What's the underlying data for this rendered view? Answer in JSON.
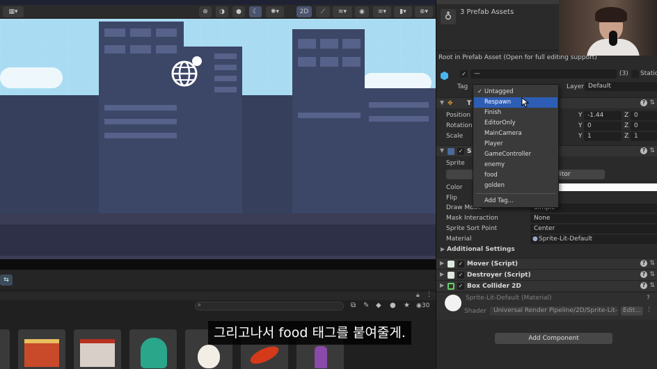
{
  "scene_toolbar": {
    "mode_2d_label": "2D"
  },
  "project_panel": {
    "visible_count": "30"
  },
  "subtitle": "그리고나서 food 태그를 붙여줄게.",
  "inspector": {
    "header_title": "3 Prefab Assets",
    "root_note": "Root in Prefab Asset (Open for full editing support)",
    "object_count": "(3)",
    "static_label": "Static",
    "object_name_placeholder": "—",
    "tag_label": "Tag",
    "layer_label": "Layer",
    "layer_value": "Default",
    "transform": {
      "letter": "T",
      "position_label": "Position",
      "rotation_label": "Rotation",
      "scale_label": "Scale",
      "y_axis": "Y",
      "z_axis": "Z",
      "position_y": "-1.44",
      "position_z": "0",
      "rotation_y": "0",
      "rotation_z": "0",
      "scale_y": "1",
      "scale_z": "1"
    },
    "sprite_renderer": {
      "letter": "S",
      "sprite_label": "Sprite",
      "sprite_editor_button": "te Editor",
      "color_label": "Color",
      "flip_label": "Flip",
      "draw_mode_label": "Draw Mode",
      "draw_mode_value": "Simple",
      "mask_interaction_label": "Mask Interaction",
      "mask_interaction_value": "None",
      "sprite_sort_point_label": "Sprite Sort Point",
      "sprite_sort_point_value": "Center",
      "material_label": "Material",
      "material_value": "Sprite-Lit-Default",
      "additional_settings": "Additional Settings"
    },
    "components": [
      {
        "label": "Mover (Script)"
      },
      {
        "label": "Destroyer (Script)"
      },
      {
        "label": "Box Collider 2D"
      }
    ],
    "material_block": {
      "title": "Sprite-Lit-Default (Material)",
      "shader_label": "Shader",
      "shader_value": "Universal Render Pipeline/2D/Sprite-Lit-",
      "edit_button": "Edit..."
    },
    "add_component_button": "Add Component"
  },
  "tag_dropdown": {
    "options": [
      {
        "label": "Untagged",
        "checked": true
      },
      {
        "label": "Respawn",
        "highlighted": true
      },
      {
        "label": "Finish"
      },
      {
        "label": "EditorOnly"
      },
      {
        "label": "MainCamera"
      },
      {
        "label": "Player"
      },
      {
        "label": "GameController"
      },
      {
        "label": "enemy"
      },
      {
        "label": "food"
      },
      {
        "label": "golden"
      }
    ],
    "add_tag": "Add Tag..."
  },
  "colors": {
    "accent_selection": "#2d5db5",
    "sky": "#a9dcf2",
    "building": "#3c4666",
    "inspector_bg": "#2a2a2a"
  }
}
